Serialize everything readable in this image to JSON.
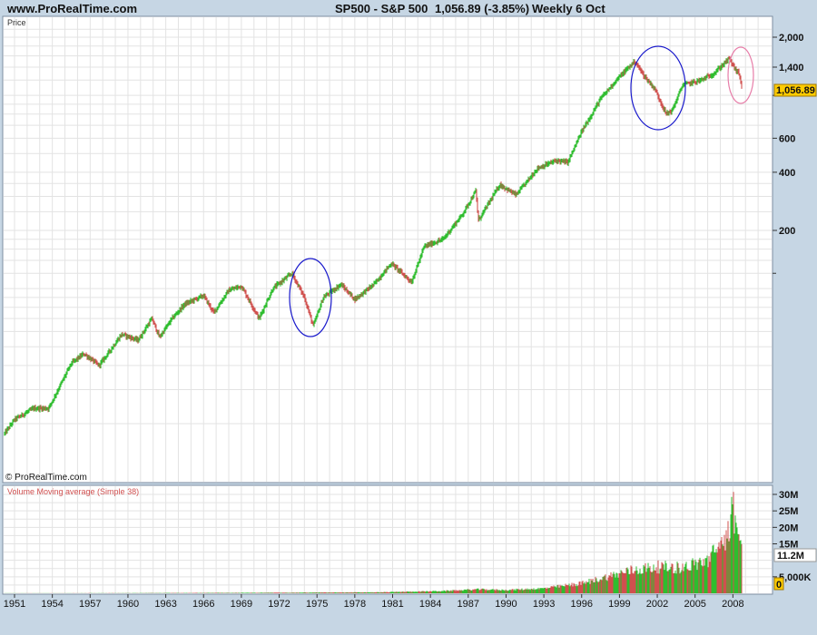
{
  "header": {
    "site": "www.ProRealTime.com",
    "instrument": "SP500 - S&P 500",
    "last": "1,056.89 (-3.85%)",
    "period": "Weekly  6 Oct"
  },
  "price_panel": {
    "label": "Price",
    "copyright": "© ProRealTime.com",
    "last_badge": "1,056.89"
  },
  "volume_panel": {
    "label": "Volume Moving average (Simple 38)",
    "last_badge": "11.2M",
    "zero_badge": "0"
  },
  "colors": {
    "up": "#2ebd2e",
    "down": "#d0504e",
    "circle_blue": "#1a1acc",
    "circle_pink": "#e77da8",
    "badge": "#ffcc00",
    "vol_badge_text": "#d03030"
  },
  "chart_data": [
    {
      "type": "line",
      "scale": "log",
      "x_ticks": [
        "1951",
        "1954",
        "1957",
        "1960",
        "1963",
        "1966",
        "1969",
        "1972",
        "1975",
        "1978",
        "1981",
        "1984",
        "1987",
        "1990",
        "1993",
        "1996",
        "1999",
        "2002",
        "2005",
        "2008"
      ],
      "y_ticks": [
        {
          "value": 2000,
          "label": "2,000"
        },
        {
          "value": 1400,
          "label": "1,400"
        },
        {
          "value": 600,
          "label": "600"
        },
        {
          "value": 400,
          "label": "400"
        },
        {
          "value": 200,
          "label": "200"
        }
      ],
      "series": [
        {
          "points": [
            [
              1950.0,
              17
            ],
            [
              1951.0,
              21
            ],
            [
              1952.5,
              24
            ],
            [
              1953.7,
              24
            ],
            [
              1955.5,
              41
            ],
            [
              1956.5,
              46
            ],
            [
              1957.7,
              40
            ],
            [
              1958.5,
              47
            ],
            [
              1959.5,
              58
            ],
            [
              1960.8,
              54
            ],
            [
              1961.9,
              70
            ],
            [
              1962.5,
              56
            ],
            [
              1963.5,
              70
            ],
            [
              1964.5,
              83
            ],
            [
              1966.0,
              92
            ],
            [
              1966.8,
              75
            ],
            [
              1968.0,
              98
            ],
            [
              1969.0,
              103
            ],
            [
              1970.4,
              70
            ],
            [
              1971.5,
              100
            ],
            [
              1973.0,
              120
            ],
            [
              1974.0,
              90
            ],
            [
              1974.7,
              64
            ],
            [
              1975.5,
              90
            ],
            [
              1976.9,
              105
            ],
            [
              1978.0,
              88
            ],
            [
              1979.5,
              105
            ],
            [
              1980.9,
              135
            ],
            [
              1982.5,
              108
            ],
            [
              1983.5,
              165
            ],
            [
              1985.0,
              180
            ],
            [
              1986.5,
              240
            ],
            [
              1987.6,
              320
            ],
            [
              1987.8,
              225
            ],
            [
              1989.5,
              345
            ],
            [
              1990.8,
              305
            ],
            [
              1992.5,
              420
            ],
            [
              1994.0,
              460
            ],
            [
              1994.9,
              450
            ],
            [
              1996.0,
              650
            ],
            [
              1997.5,
              960
            ],
            [
              1998.8,
              1210
            ],
            [
              2000.2,
              1500
            ],
            [
              2001.0,
              1250
            ],
            [
              2001.8,
              1080
            ],
            [
              2002.7,
              800
            ],
            [
              2003.2,
              840
            ],
            [
              2004.0,
              1130
            ],
            [
              2005.5,
              1200
            ],
            [
              2006.5,
              1300
            ],
            [
              2007.7,
              1550
            ],
            [
              2008.2,
              1360
            ],
            [
              2008.5,
              1290
            ],
            [
              2008.76,
              1056.89
            ]
          ]
        }
      ],
      "annotations": [
        {
          "shape": "ellipse",
          "color": "blue",
          "around": "1973-1975 decline"
        },
        {
          "shape": "ellipse",
          "color": "blue",
          "around": "2000-2002 decline"
        },
        {
          "shape": "ellipse",
          "color": "pink",
          "around": "2008 decline"
        }
      ]
    },
    {
      "type": "bar",
      "ylim": [
        0,
        30000000
      ],
      "y_ticks": [
        {
          "value": 30000000,
          "label": "30M"
        },
        {
          "value": 25000000,
          "label": "25M"
        },
        {
          "value": 20000000,
          "label": "20M"
        },
        {
          "value": 15000000,
          "label": "15M"
        },
        {
          "value": 5000000,
          "label": "5,000K"
        }
      ],
      "profile": [
        [
          1950,
          20000
        ],
        [
          1960,
          60000
        ],
        [
          1970,
          150000
        ],
        [
          1980,
          300000
        ],
        [
          1985,
          700000
        ],
        [
          1987.8,
          1200000
        ],
        [
          1990,
          1000000
        ],
        [
          1993,
          1500000
        ],
        [
          1996,
          3000000
        ],
        [
          1998,
          5000000
        ],
        [
          2000,
          7000000
        ],
        [
          2002,
          8000000
        ],
        [
          2004,
          7800000
        ],
        [
          2006,
          10000000
        ],
        [
          2007.5,
          17000000
        ],
        [
          2008.2,
          22000000
        ],
        [
          2008.76,
          11200000
        ]
      ]
    }
  ]
}
